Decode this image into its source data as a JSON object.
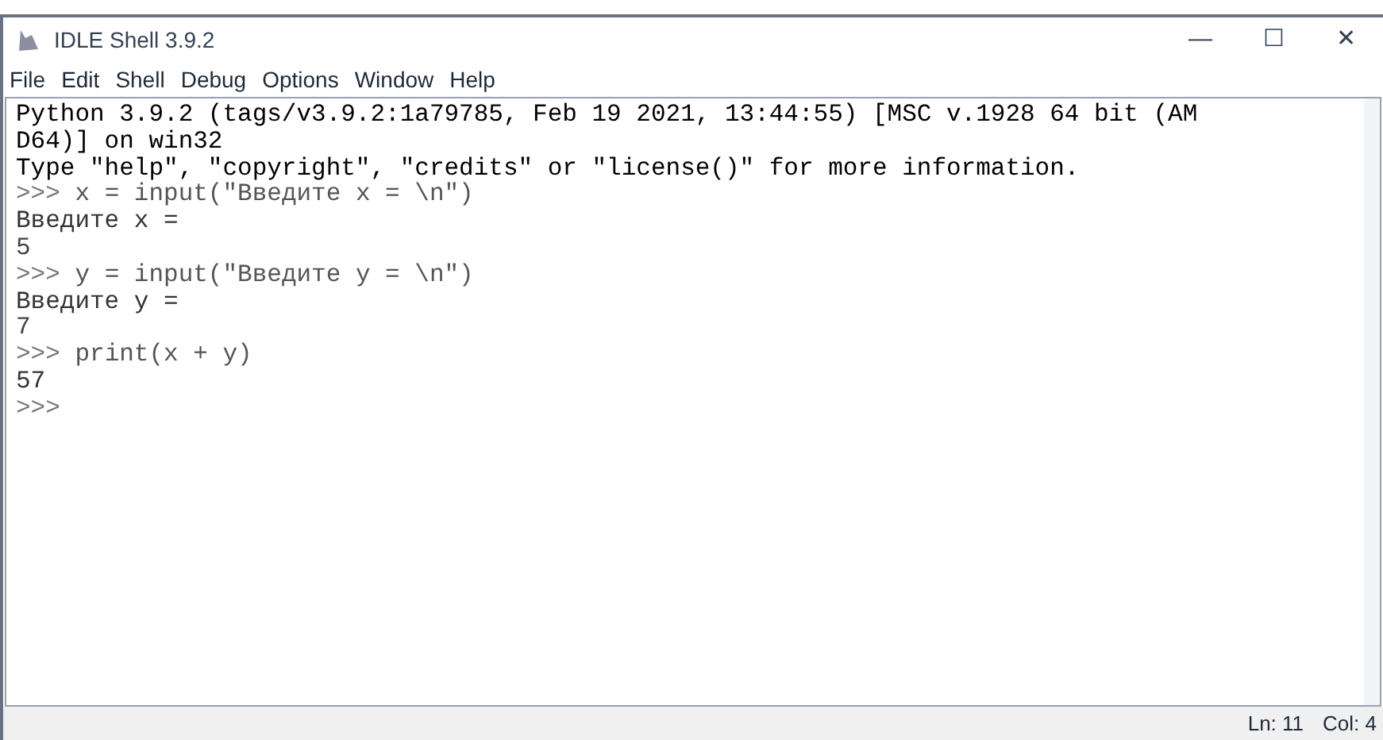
{
  "window": {
    "title": "IDLE Shell 3.9.2",
    "controls": [
      "—",
      "☐",
      "✕"
    ]
  },
  "menu": [
    "File",
    "Edit",
    "Shell",
    "Debug",
    "Options",
    "Window",
    "Help"
  ],
  "shell": {
    "lines": [
      {
        "kind": "output",
        "text": "Python 3.9.2 (tags/v3.9.2:1a79785, Feb 19 2021, 13:44:55) [MSC v.1928 64 bit (AM"
      },
      {
        "kind": "output",
        "text": "D64)] on win32"
      },
      {
        "kind": "output",
        "text": "Type \"help\", \"copyright\", \"credits\" or \"license()\" for more information."
      },
      {
        "kind": "prompt",
        "prompt": ">>>",
        "text": "x = input(\"Введите x = \\n\")"
      },
      {
        "kind": "stdout",
        "text": "Введите x ="
      },
      {
        "kind": "stdin",
        "text": "5"
      },
      {
        "kind": "prompt",
        "prompt": ">>>",
        "text": "y = input(\"Введите y = \\n\")"
      },
      {
        "kind": "stdout",
        "text": "Введите y ="
      },
      {
        "kind": "stdin",
        "text": "7"
      },
      {
        "kind": "prompt",
        "prompt": ">>>",
        "text": "print(x + y)"
      },
      {
        "kind": "stdout",
        "text": "57"
      },
      {
        "kind": "prompt",
        "prompt": ">>>"
      }
    ]
  },
  "status_bar": {
    "line": "Ln: 11",
    "column": "Col: 4"
  }
}
